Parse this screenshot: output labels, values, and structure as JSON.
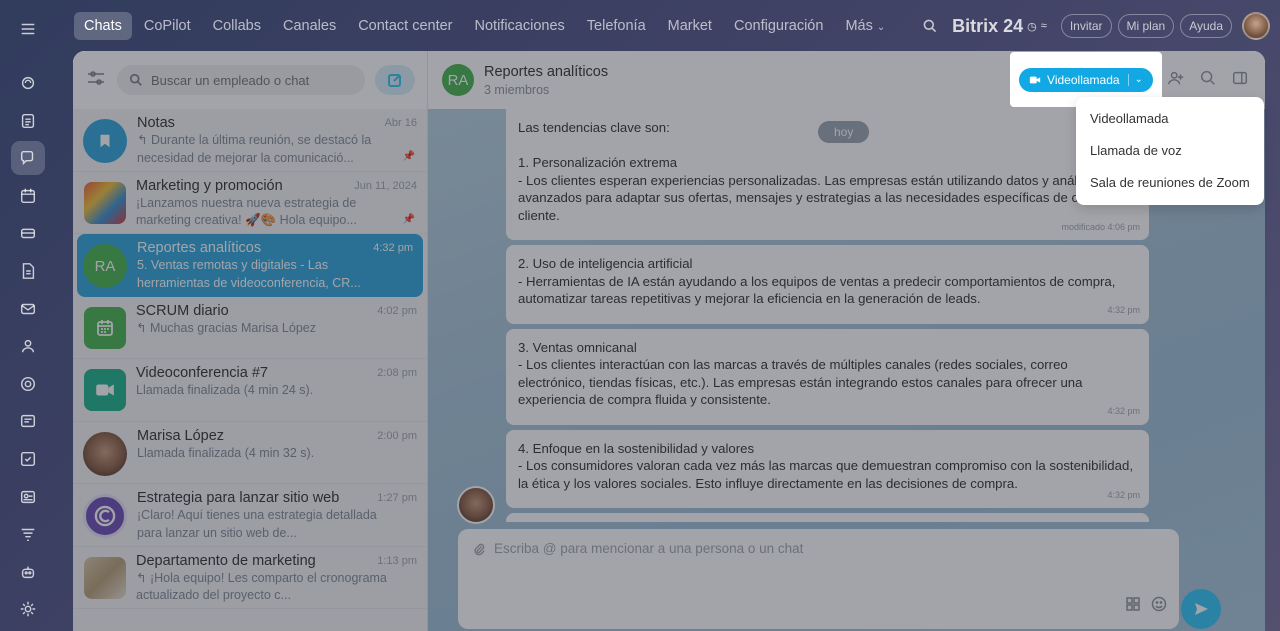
{
  "nav": {
    "tabs": [
      "Chats",
      "CoPilot",
      "Collabs",
      "Canales",
      "Contact center",
      "Notificaciones",
      "Telefonía",
      "Market",
      "Configuración",
      "Más"
    ],
    "brand": "Bitrix 24",
    "invite": "Invitar",
    "my_plan": "Mi plan",
    "help": "Ayuda"
  },
  "search": {
    "placeholder": "Buscar un empleado o chat"
  },
  "chats": [
    {
      "name": "Notas",
      "time": "Abr 16",
      "msg": "↰ Durante la última reunión, se destacó la necesidad de mejorar la comunicació...",
      "avatar": "bookmark-icon",
      "color": "#2fa6dc"
    },
    {
      "name": "Marketing y promoción",
      "time": "Jun 11, 2024",
      "msg": "¡Lanzamos nuestra nueva estrategia de marketing creativa! 🚀🎨 Hola equipo...",
      "avatar": "marketing-image",
      "color": "#e8603c"
    },
    {
      "name": "Reportes analíticos",
      "time": "4:32 pm",
      "msg": "5. Ventas remotas y digitales - Las herramientas de videoconferencia, CR...",
      "avatar_text": "RA",
      "color": "#47b34f"
    },
    {
      "name": "SCRUM diario",
      "time": "4:02 pm",
      "msg": "↰ Muchas gracias Marisa López",
      "avatar": "calendar-icon",
      "color": "#47b34f"
    },
    {
      "name": "Videoconferencia #7",
      "time": "2:08 pm",
      "msg": "Llamada finalizada (4 min 24 s).",
      "avatar": "video-icon",
      "color": "#1db18a"
    },
    {
      "name": "Marisa López",
      "time": "2:00 pm",
      "msg": "Llamada finalizada (4 min 32 s).",
      "avatar": "user-photo",
      "color": "#a47a5e"
    },
    {
      "name": "Estrategia para lanzar sitio web",
      "time": "1:27 pm",
      "msg": "¡Claro! Aquí tienes una estrategia detallada para lanzar un sitio web de...",
      "avatar": "copilot-icon",
      "color": "#6b4fb5"
    },
    {
      "name": "Departamento de marketing",
      "time": "1:13 pm",
      "msg": "↰ ¡Hola equipo! Les comparto el cronograma actualizado del proyecto c...",
      "avatar": "document-image",
      "color": "#c7b38e"
    }
  ],
  "chat": {
    "avatar_text": "RA",
    "title": "Reportes analíticos",
    "subtitle": "3 miembros",
    "date_chip": "hoy",
    "messages": [
      {
        "text": "Las tendencias clave son:\n\n1. Personalización extrema\n- Los clientes esperan experiencias personalizadas. Las empresas están utilizando datos y análisis avanzados para adaptar sus ofertas, mensajes y estrategias a las necesidades específicas de cada cliente.",
        "time": "modificado 4:06 pm"
      },
      {
        "text": "2. Uso de inteligencia artificial\n- Herramientas de IA están ayudando a los equipos de ventas a predecir comportamientos de compra, automatizar tareas repetitivas y mejorar la eficiencia en la generación de leads.",
        "time": "4:32 pm"
      },
      {
        "text": "3. Ventas omnicanal\n- Los clientes interactúan con las marcas a través de múltiples canales (redes sociales, correo electrónico, tiendas físicas, etc.). Las empresas están integrando estos canales para ofrecer una experiencia de compra fluida y consistente.",
        "time": "4:32 pm"
      },
      {
        "text": "4. Enfoque en la sostenibilidad y valores\n- Los consumidores valoran cada vez más las marcas que demuestran compromiso con la sostenibilidad, la ética y los valores sociales. Esto influye directamente en las decisiones de compra.",
        "time": "4:32 pm"
      }
    ],
    "composer_placeholder": "Escriba @ para mencionar a una persona o un chat"
  },
  "call": {
    "button_label": "Videollamada",
    "options": [
      "Videollamada",
      "Llamada de voz",
      "Sala de reuniones de Zoom"
    ]
  },
  "colors": {
    "accent": "#2fc6f6",
    "active_chat": "#2fa6dc",
    "call_button": "#11a8e3"
  }
}
